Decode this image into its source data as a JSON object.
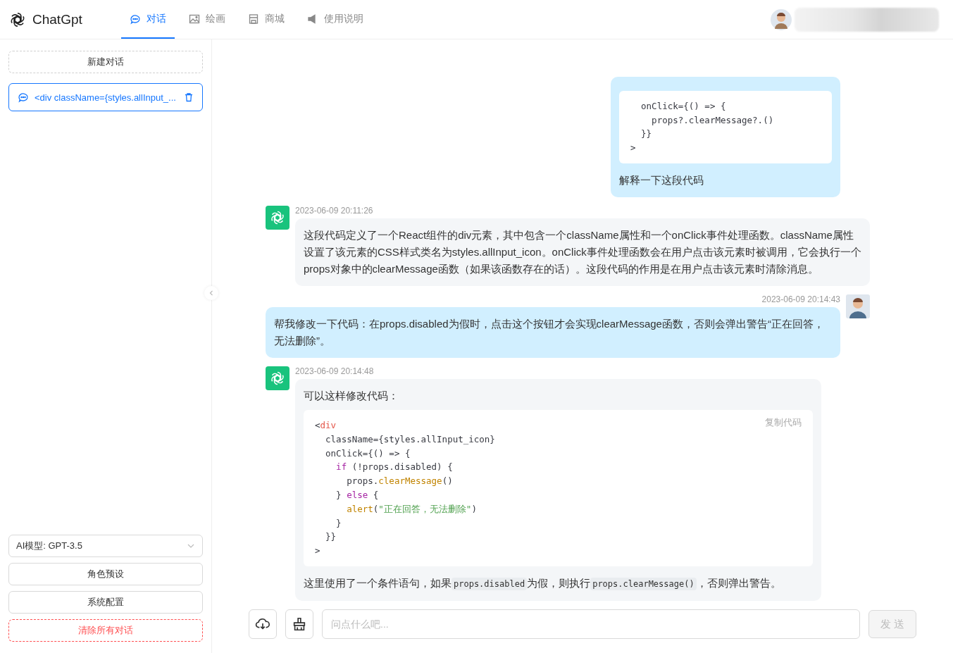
{
  "header": {
    "brand": "ChatGpt",
    "tabs": [
      {
        "label": "对话",
        "kind": "chat",
        "selected": true
      },
      {
        "label": "绘画",
        "kind": "image",
        "selected": false
      },
      {
        "label": "商城",
        "kind": "shop",
        "selected": false
      },
      {
        "label": "使用说明",
        "kind": "speaker",
        "selected": false
      }
    ]
  },
  "sidebar": {
    "new_chat": "新建对话",
    "conversations": [
      {
        "title": "<div className={styles.allInput_...",
        "selected": true
      }
    ],
    "model_select": "AI模型: GPT-3.5",
    "buttons": [
      {
        "label": "角色预设",
        "kind": "normal"
      },
      {
        "label": "系统配置",
        "kind": "normal"
      },
      {
        "label": "清除所有对话",
        "kind": "danger"
      }
    ]
  },
  "messages": [
    {
      "kind": "user",
      "code": [
        [
          {
            "t": "  onClick={() => {",
            "kind": "plain"
          }
        ],
        [
          {
            "t": "    props?.clearMessage?.()",
            "kind": "plain"
          }
        ],
        [
          {
            "t": "  }}",
            "kind": "plain"
          }
        ],
        [
          {
            "t": ">",
            "kind": "plain"
          }
        ]
      ],
      "text": [
        {
          "t": "解释一下这段代码",
          "kind": "text"
        }
      ]
    },
    {
      "kind": "bot",
      "time": "2023-06-09 20:11:26",
      "text": [
        {
          "t": "这段代码定义了一个React组件的div元素，其中包含一个className属性和一个onClick事件处理函数。className属性设置了该元素的CSS样式类名为styles.allInput_icon。onClick事件处理函数会在用户点击该元素时被调用，它会执行一个props对象中的clearMessage函数（如果该函数存在的话）。这段代码的作用是在用户点击该元素时清除消息。",
          "kind": "text"
        }
      ]
    },
    {
      "kind": "user",
      "time": "2023-06-09 20:14:43",
      "text": [
        {
          "t": "帮我修改一下代码：在props.disabled为假时，点击这个按钮才会实现clearMessage函数，否则会弹出警告“正在回答，无法删除”。",
          "kind": "text"
        }
      ]
    },
    {
      "kind": "bot",
      "time": "2023-06-09 20:14:48",
      "intro": "可以这样修改代码：",
      "copy_label": "复制代码",
      "code": [
        [
          {
            "t": "<",
            "kind": "plain"
          },
          {
            "t": "div",
            "kind": "tag"
          }
        ],
        [
          {
            "t": "  className={styles.allInput_icon}",
            "kind": "plain"
          }
        ],
        [
          {
            "t": "  onClick={() => {",
            "kind": "plain"
          }
        ],
        [
          {
            "t": "    if",
            "kind": "keyword"
          },
          {
            "t": " (!props.disabled) {",
            "kind": "plain"
          }
        ],
        [
          {
            "t": "      props.",
            "kind": "plain"
          },
          {
            "t": "clearMessage",
            "kind": "func"
          },
          {
            "t": "()",
            "kind": "plain"
          }
        ],
        [
          {
            "t": "    } ",
            "kind": "plain"
          },
          {
            "t": "else",
            "kind": "keyword"
          },
          {
            "t": " {",
            "kind": "plain"
          }
        ],
        [
          {
            "t": "      alert",
            "kind": "func"
          },
          {
            "t": "(",
            "kind": "plain"
          },
          {
            "t": "\"正在回答，无法删除\"",
            "kind": "string"
          },
          {
            "t": ")",
            "kind": "plain"
          }
        ],
        [
          {
            "t": "    }",
            "kind": "plain"
          }
        ],
        [
          {
            "t": "  }}",
            "kind": "plain"
          }
        ],
        [
          {
            "t": ">",
            "kind": "plain"
          }
        ]
      ],
      "text": [
        {
          "t": "这里使用了一个条件语句，如果",
          "kind": "text"
        },
        {
          "t": "props.disabled",
          "kind": "code"
        },
        {
          "t": "为假，则执行",
          "kind": "text"
        },
        {
          "t": "props.clearMessage()",
          "kind": "code"
        },
        {
          "t": "，否则弹出警告。",
          "kind": "text"
        }
      ]
    }
  ],
  "composer": {
    "placeholder": "问点什么吧...",
    "send": "发 送",
    "send_disabled": true
  }
}
